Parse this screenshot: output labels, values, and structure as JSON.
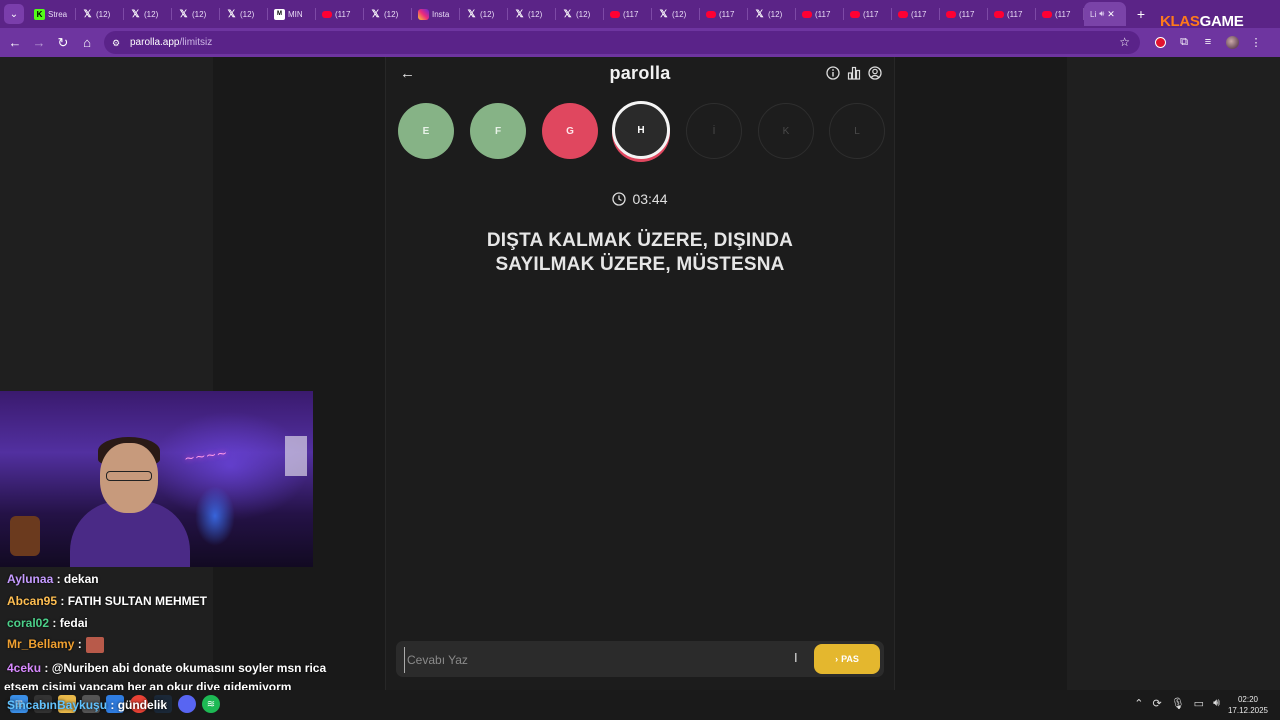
{
  "browser": {
    "tabs": [
      {
        "icon": "kick-icon",
        "label": "Strea"
      },
      {
        "icon": "x-icon",
        "label": "(12)"
      },
      {
        "icon": "x-icon",
        "label": "(12)"
      },
      {
        "icon": "x-icon",
        "label": "(12)"
      },
      {
        "icon": "x-icon",
        "label": "(12)"
      },
      {
        "icon": "mint-icon",
        "label": "MIN"
      },
      {
        "icon": "youtube-icon",
        "label": "(117"
      },
      {
        "icon": "x-icon",
        "label": "(12)"
      },
      {
        "icon": "instagram-icon",
        "label": "Insta"
      },
      {
        "icon": "x-icon",
        "label": "(12)"
      },
      {
        "icon": "x-icon",
        "label": "(12)"
      },
      {
        "icon": "x-icon",
        "label": "(12)"
      },
      {
        "icon": "youtube-icon",
        "label": "(117"
      },
      {
        "icon": "x-icon",
        "label": "(12)"
      },
      {
        "icon": "youtube-icon",
        "label": "(117"
      },
      {
        "icon": "x-icon",
        "label": "(12)"
      },
      {
        "icon": "youtube-icon",
        "label": "(117"
      },
      {
        "icon": "youtube-icon",
        "label": "(117"
      },
      {
        "icon": "youtube-icon",
        "label": "(117"
      },
      {
        "icon": "youtube-icon",
        "label": "(117"
      },
      {
        "icon": "youtube-icon",
        "label": "(117"
      },
      {
        "icon": "youtube-icon",
        "label": "(117"
      }
    ],
    "active_tab": {
      "label": "Li",
      "icons": [
        "speaker-icon",
        "close-icon"
      ]
    },
    "new_tab": "+",
    "brand": {
      "part1": "KLAS",
      "part2": "GAME"
    },
    "url_host": "parolla.app",
    "url_path": "/limitsiz"
  },
  "app": {
    "title": "parolla",
    "letters": [
      {
        "letter": "E",
        "state": "correct"
      },
      {
        "letter": "F",
        "state": "correct"
      },
      {
        "letter": "G",
        "state": "wrong"
      },
      {
        "letter": "H",
        "state": "current"
      },
      {
        "letter": "İ",
        "state": "pending"
      },
      {
        "letter": "K",
        "state": "pending"
      },
      {
        "letter": "L",
        "state": "pending"
      }
    ],
    "timer": "03:44",
    "question_line1": "DIŞTA KALMAK ÜZERE, DIŞINDA",
    "question_line2": "SAYILMAK ÜZERE, MÜSTESNA",
    "answer_placeholder": "Cevabı Yaz",
    "pass_label": "PAS",
    "colors": {
      "correct": "#86b386",
      "wrong": "#e0475f",
      "pass": "#e4b72e"
    }
  },
  "chat": [
    {
      "user": "Aylunaa",
      "msg": " : dekan",
      "color": "purple"
    },
    {
      "user": "Abcan95",
      "msg": " : FATIH SULTAN MEHMET",
      "color": "orange"
    },
    {
      "user": "coral02",
      "msg": " : fedai",
      "color": "green"
    },
    {
      "user": "Mr_Bellamy",
      "msg": " :",
      "color": "gold"
    },
    {
      "user": "4ceku",
      "msg": " : @Nuriben abi donate okumasını soyler msn rica",
      "color": "pink"
    }
  ],
  "chat_continuation": "etsem cisimi yapcam her an okur diye gidemiyorm",
  "chat_last": {
    "user": "SincabınBaykuşu",
    "msg": " : gündelik"
  },
  "taskbar": {
    "time": "02:20",
    "date": "17.12.2025"
  }
}
